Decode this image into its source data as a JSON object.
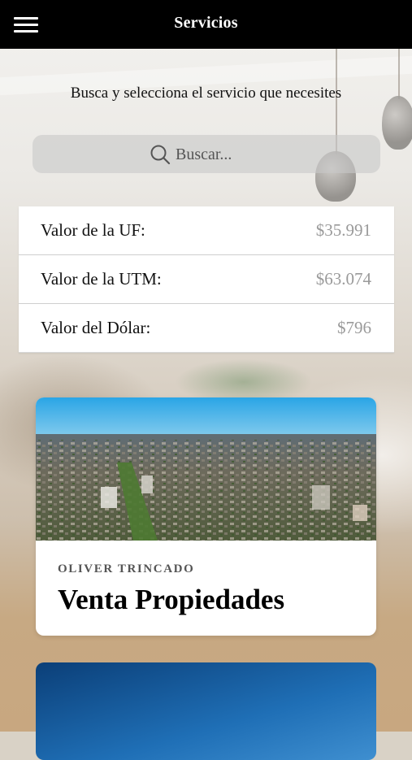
{
  "header": {
    "title": "Servicios",
    "menu_icon": "hamburger-menu-icon"
  },
  "subtitle": "Busca y selecciona el servicio que necesites",
  "search": {
    "placeholder": "Buscar...",
    "value": "",
    "icon": "search-icon"
  },
  "rates": [
    {
      "label": "Valor de la UF:",
      "value": "$35.991"
    },
    {
      "label": "Valor de la UTM:",
      "value": "$63.074"
    },
    {
      "label": "Valor del Dólar:",
      "value": "$796"
    }
  ],
  "cards": [
    {
      "author": "OLIVER TRINCADO",
      "title": "Venta Propiedades",
      "image": "aerial-city-photo"
    },
    {
      "image": "blue-sky-photo"
    }
  ],
  "colors": {
    "header_bg": "#000000",
    "header_text": "#ffffff",
    "rate_value": "#9a9a9a"
  }
}
